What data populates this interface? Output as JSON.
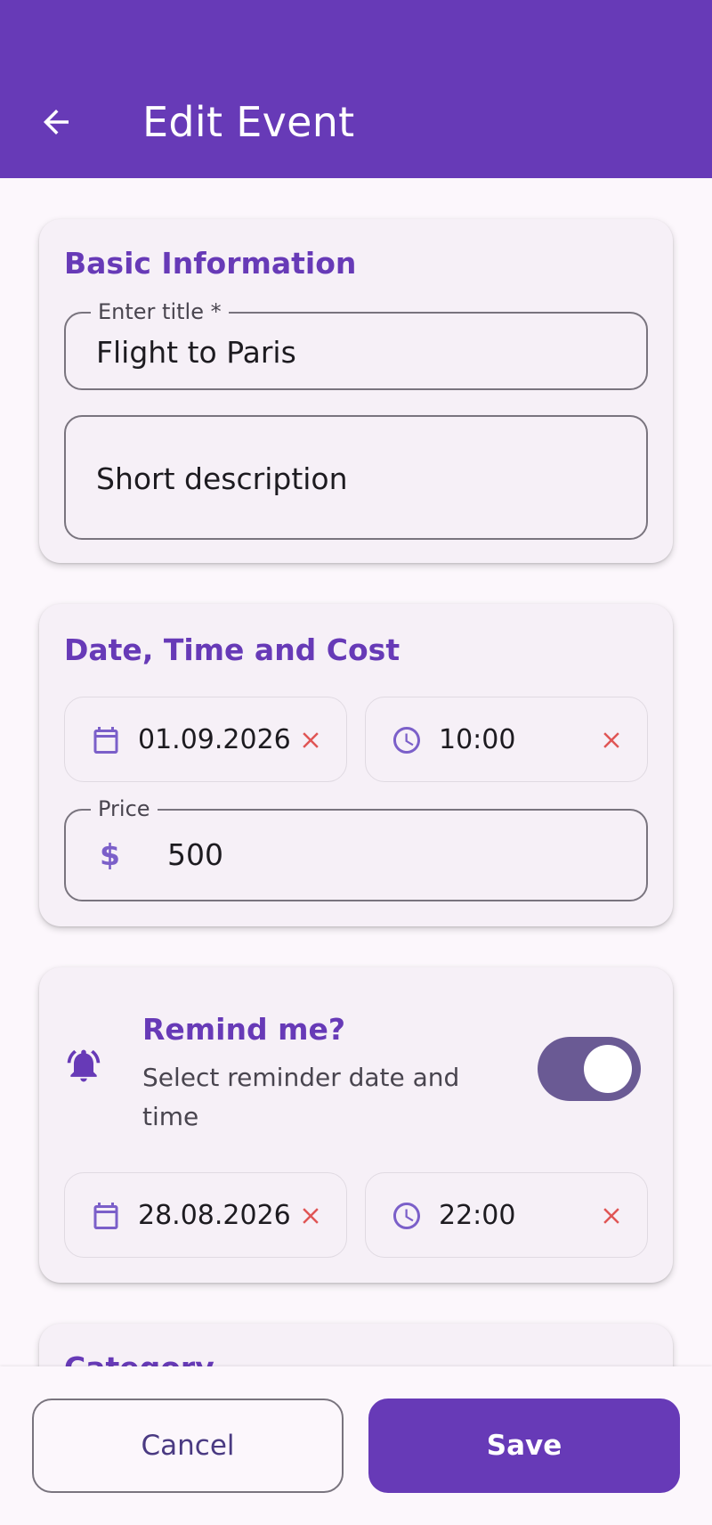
{
  "appbar": {
    "title": "Edit Event",
    "back_icon": "arrow-left-icon"
  },
  "basic_info": {
    "title": "Basic Information",
    "title_field": {
      "label": "Enter title *",
      "value": "Flight to Paris"
    },
    "description_field": {
      "placeholder": "Short description",
      "value": ""
    }
  },
  "date_time_cost": {
    "title": "Date, Time and Cost",
    "date": {
      "icon": "calendar-icon",
      "value": "01.09.2026"
    },
    "time": {
      "icon": "clock-icon",
      "value": "10:00"
    },
    "price": {
      "label": "Price",
      "currency_symbol": "$",
      "value": "500"
    }
  },
  "reminder": {
    "title": "Remind me?",
    "subtitle": "Select reminder date and time",
    "icon": "bell-ring-icon",
    "enabled": true,
    "date": {
      "icon": "calendar-icon",
      "value": "28.08.2026"
    },
    "time": {
      "icon": "clock-icon",
      "value": "22:00"
    }
  },
  "category": {
    "title": "Category"
  },
  "actions": {
    "cancel_label": "Cancel",
    "save_label": "Save"
  },
  "colors": {
    "primary": "#673ab7",
    "clear_icon": "#e05555",
    "toggle_track": "#6a5a94",
    "background": "#fcf7fc"
  }
}
